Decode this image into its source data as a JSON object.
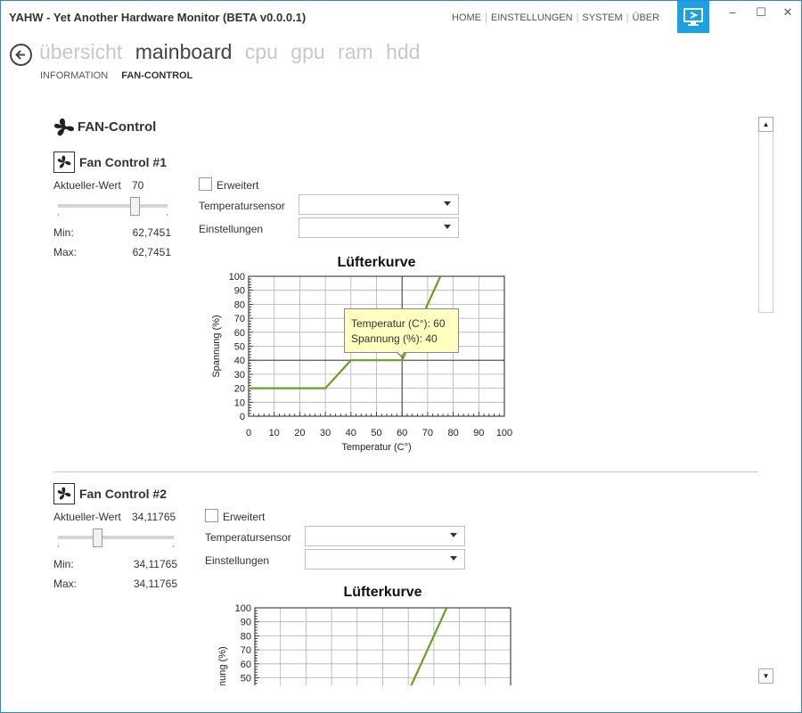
{
  "window": {
    "title": "YAHW - Yet Another Hardware Monitor (BETA v0.0.0.1)",
    "top_nav": [
      "HOME",
      "EINSTELLUNGEN",
      "SYSTEM",
      "ÜBER"
    ],
    "minimize_glyph": "–",
    "maximize_glyph": "☐",
    "close_glyph": "✕"
  },
  "main_nav": {
    "items": [
      "übersicht",
      "mainboard",
      "cpu",
      "gpu",
      "ram",
      "hdd"
    ],
    "active": "mainboard"
  },
  "sub_nav": {
    "items": [
      "INFORMATION",
      "FAN-CONTROL"
    ],
    "active": "FAN-CONTROL"
  },
  "section": {
    "title": "FAN-Control",
    "icon": "fan-icon"
  },
  "fan_controls": [
    {
      "title": "Fan Control #1",
      "current_label": "Aktueller-Wert",
      "current_value": "70",
      "slider_level": 0.7,
      "min_label": "Min:",
      "min_value": "62,7451",
      "max_label": "Max:",
      "max_value": "62,7451",
      "advanced_label": "Erweitert",
      "advanced_checked": false,
      "sensor_label": "Temperatursensor",
      "sensor_value": "",
      "settings_label": "Einstellungen",
      "settings_value": "",
      "tooltip": {
        "temp_label": "Temperatur (C°): 60",
        "volt_label": "Spannung (%): 40"
      }
    },
    {
      "title": "Fan Control #2",
      "current_label": "Aktueller-Wert",
      "current_value": "34,11765",
      "slider_level": 0.34,
      "min_label": "Min:",
      "min_value": "34,11765",
      "max_label": "Max:",
      "max_value": "34,11765",
      "advanced_label": "Erweitert",
      "advanced_checked": false,
      "sensor_label": "Temperatursensor",
      "sensor_value": "",
      "settings_label": "Einstellungen",
      "settings_value": "",
      "tooltip": null
    }
  ],
  "colors": {
    "accent": "#1ba1e2",
    "curve": "#6aa121",
    "grid": "#b0b0b0"
  },
  "chart_data": [
    {
      "type": "line",
      "title": "Lüfterkurve",
      "xlabel": "Temperatur (C°)",
      "ylabel": "Spannung (%)",
      "xlim": [
        0,
        100
      ],
      "ylim": [
        0,
        100
      ],
      "xticks": [
        0,
        10,
        20,
        30,
        40,
        50,
        60,
        70,
        80,
        90,
        100
      ],
      "yticks": [
        0,
        10,
        20,
        30,
        40,
        50,
        60,
        70,
        80,
        90,
        100
      ],
      "grid": true,
      "series": [
        {
          "x": [
            0,
            30,
            40,
            60,
            75
          ],
          "y": [
            20,
            20,
            40,
            40,
            100
          ]
        }
      ],
      "crosshair": {
        "x": 60,
        "y": 40
      }
    },
    {
      "type": "line",
      "title": "Lüfterkurve",
      "xlabel": "",
      "ylabel": "Spannung (%)",
      "xlim": [
        0,
        100
      ],
      "ylim": [
        0,
        100
      ],
      "xticks": [],
      "yticks": [
        50,
        60,
        70,
        80,
        90,
        100
      ],
      "grid": true,
      "series": [
        {
          "x": [
            60,
            75
          ],
          "y": [
            40,
            100
          ]
        }
      ]
    }
  ]
}
